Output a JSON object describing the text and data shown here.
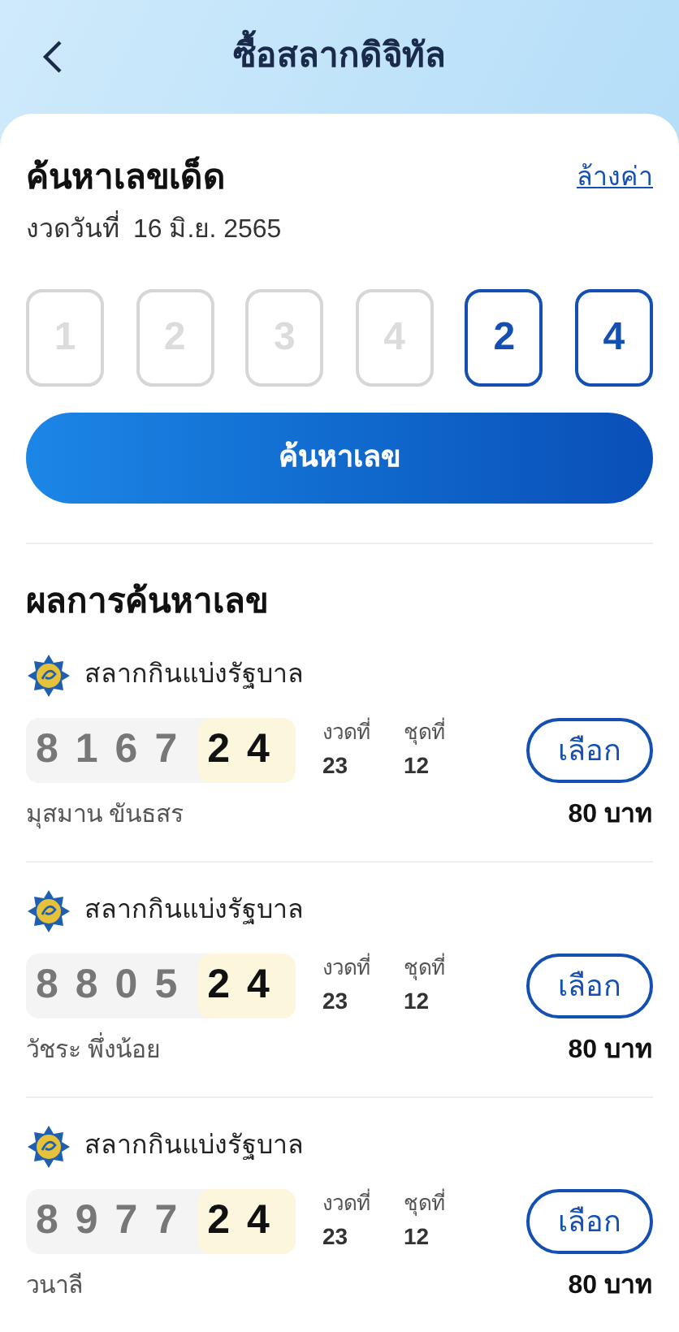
{
  "header": {
    "title": "ซื้อสลากดิจิทัล"
  },
  "search": {
    "title": "ค้นหาเลขเด็ด",
    "clear_link": "ล้างค่า",
    "draw_label": "งวดวันที่",
    "draw_date": "16 มิ.ย. 2565",
    "digits": [
      {
        "placeholder": "1"
      },
      {
        "placeholder": "2"
      },
      {
        "placeholder": "3"
      },
      {
        "placeholder": "4"
      },
      {
        "value": "2"
      },
      {
        "value": "4"
      }
    ],
    "button": "ค้นหาเลข"
  },
  "results": {
    "title": "ผลการค้นหาเลข",
    "items": [
      {
        "issuer": "สลากกินแบ่งรัฐบาล",
        "prefix": "8167",
        "matched": "24",
        "draw_label": "งวดที่",
        "draw": "23",
        "set_label": "ชุดที่",
        "set": "12",
        "button": "เลือก",
        "seller": "มุสมาน ขันธสร",
        "price": "80 บาท"
      },
      {
        "issuer": "สลากกินแบ่งรัฐบาล",
        "prefix": "8805",
        "matched": "24",
        "draw_label": "งวดที่",
        "draw": "23",
        "set_label": "ชุดที่",
        "set": "12",
        "button": "เลือก",
        "seller": "วัชระ พึ่งน้อย",
        "price": "80 บาท"
      },
      {
        "issuer": "สลากกินแบ่งรัฐบาล",
        "prefix": "8977",
        "matched": "24",
        "draw_label": "งวดที่",
        "draw": "23",
        "set_label": "ชุดที่",
        "set": "12",
        "button": "เลือก",
        "seller": "วนาลี",
        "price": "80 บาท"
      }
    ]
  }
}
